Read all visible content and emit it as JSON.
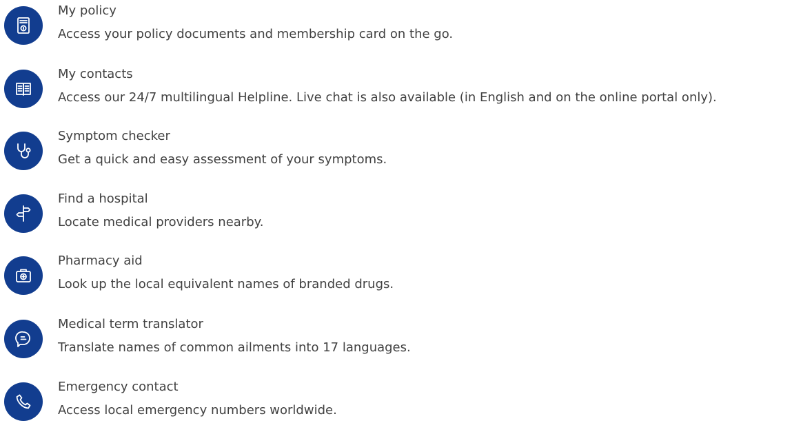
{
  "features": [
    {
      "title": "My policy",
      "description": "Access your policy documents and membership card on the go.",
      "icon": "policy-document-icon"
    },
    {
      "title": "My contacts",
      "description": "Access our 24/7 multilingual Helpline. Live chat is also available (in English and on the online portal only).",
      "icon": "contact-book-icon"
    },
    {
      "title": "Symptom checker",
      "description": "Get a quick and easy assessment of your symptoms.",
      "icon": "stethoscope-icon"
    },
    {
      "title": "Find a hospital",
      "description": "Locate medical providers nearby.",
      "icon": "signpost-icon"
    },
    {
      "title": "Pharmacy aid",
      "description": "Look up the local equivalent names of branded drugs.",
      "icon": "medical-kit-icon"
    },
    {
      "title": "Medical term translator",
      "description": "Translate names of common ailments into 17 languages.",
      "icon": "speech-bubble-icon"
    },
    {
      "title": "Emergency contact",
      "description": "Access local emergency numbers worldwide.",
      "icon": "phone-icon"
    }
  ],
  "colors": {
    "icon_background": "#123d8f",
    "icon_stroke": "#ffffff",
    "text": "#414141"
  }
}
